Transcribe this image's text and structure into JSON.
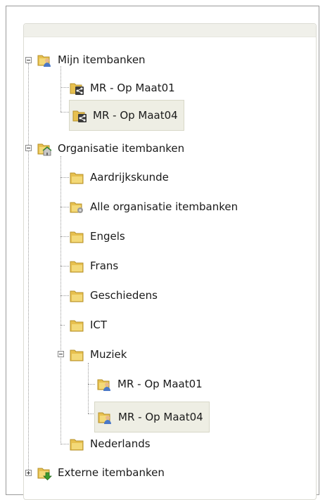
{
  "tree": {
    "mijn": {
      "label": "Mijn itembanken",
      "children": [
        "MR - Op Maat01",
        "MR - Op Maat04"
      ]
    },
    "organisatie": {
      "label": "Organisatie itembanken",
      "children": [
        "Aardrijkskunde",
        "Alle organisatie itembanken",
        "Engels",
        "Frans",
        "Geschiedens",
        "ICT",
        "Muziek",
        "Nederlands"
      ],
      "muziek_children": [
        "MR - Op Maat01",
        "MR - Op Maat04"
      ]
    },
    "externe": {
      "label": "Externe itembanken"
    }
  },
  "colors": {
    "folder": "#e7c04f",
    "selection": "#eeeee4",
    "person": "#4a78c8",
    "share": "#3b3b3b",
    "green_arrow": "#3c9a2e"
  }
}
